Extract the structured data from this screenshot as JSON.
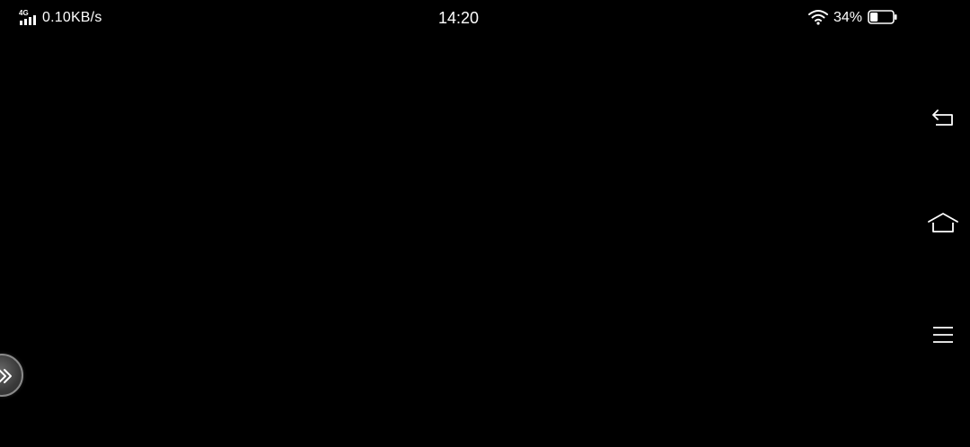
{
  "status_bar": {
    "network_type": "4G",
    "network_speed": "0.10KB/s",
    "time": "14:20",
    "battery_percent": "34%",
    "battery_level": 0.34,
    "icons": {
      "network": "signal-4g-icon",
      "wifi": "wifi-icon",
      "battery": "battery-icon"
    }
  },
  "nav_bar": {
    "buttons": [
      {
        "id": "back",
        "icon": "back-icon"
      },
      {
        "id": "home",
        "icon": "home-icon"
      },
      {
        "id": "menu",
        "icon": "menu-icon"
      }
    ]
  },
  "floating_ball": {
    "icon": "double-chevron-icon"
  },
  "colors": {
    "background": "#000000",
    "foreground": "#ffffff"
  }
}
